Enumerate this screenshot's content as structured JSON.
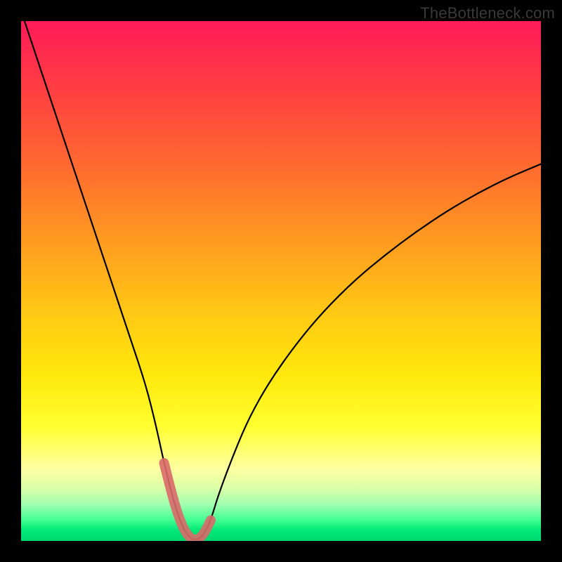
{
  "watermark": "TheBottleneck.com",
  "colors": {
    "frame": "#000000",
    "curve": "#000000",
    "overlay": "#d96a6a",
    "gradient_top": "#ff1a58",
    "gradient_bottom": "#00d870"
  },
  "chart_data": {
    "type": "line",
    "title": "",
    "xlabel": "",
    "ylabel": "",
    "xlim": [
      0,
      100
    ],
    "ylim": [
      0,
      100
    ],
    "series": [
      {
        "name": "bottleneck-curve",
        "x": [
          0,
          3,
          6,
          9,
          12,
          15,
          18,
          21,
          24,
          26,
          27.5,
          29,
          30.5,
          32,
          33.5,
          35,
          36.5,
          38,
          41,
          44,
          48,
          53,
          58,
          64,
          70,
          76,
          82,
          88,
          94,
          100
        ],
        "y": [
          102,
          93,
          84,
          75,
          66,
          57,
          48,
          39,
          30,
          22,
          15,
          9,
          4,
          1,
          0,
          1,
          4,
          9,
          17,
          24,
          31,
          38,
          44,
          50,
          55,
          59.5,
          63.5,
          67,
          70,
          72.5
        ]
      }
    ],
    "overlay_region": {
      "name": "minimum-highlight",
      "x": [
        27.5,
        29,
        30.5,
        32,
        33.5,
        35,
        36.5
      ],
      "y": [
        15,
        9,
        4,
        1,
        0,
        1,
        4
      ]
    }
  }
}
